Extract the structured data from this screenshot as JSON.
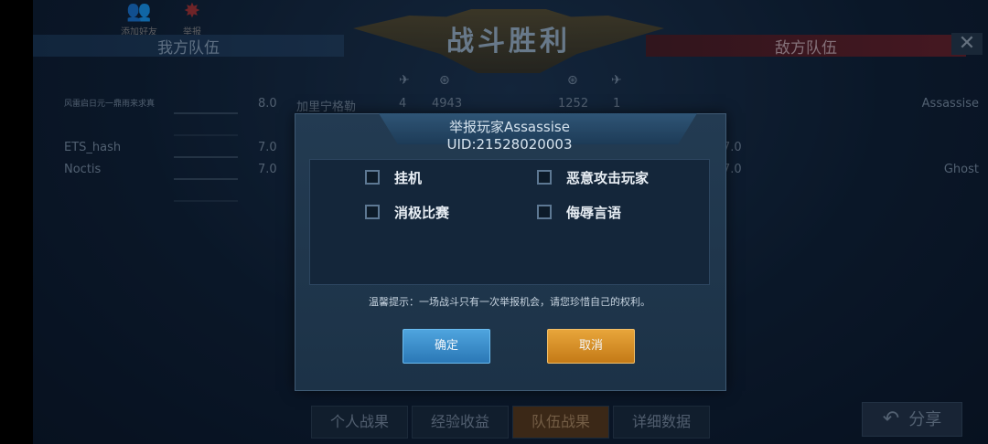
{
  "top_icons": [
    {
      "icon": "friends-icon",
      "label": "添加好友"
    },
    {
      "icon": "report-icon",
      "label": "举报"
    }
  ],
  "banner_title": "战斗胜利",
  "teams": {
    "ally": "我方队伍",
    "enemy": "敌方队伍"
  },
  "ally_rows": [
    {
      "name": "风雷启日元一鼎雨来求真",
      "score": "8.0",
      "enemy_name": "加里宁格勒",
      "k": "4",
      "dmg": "4943",
      "enemy_score": "1252",
      "enemy_k": "1",
      "enemy_player": "Assassise"
    },
    {
      "name": "",
      "score": "",
      "enemy_name": "",
      "k": "",
      "dmg": "",
      "enemy_score": "",
      "enemy_k": "",
      "enemy_player": ""
    },
    {
      "name": "ETS_hash",
      "score": "7.0",
      "enemy_name": "",
      "k": "",
      "dmg": "",
      "enemy_score": "7.0",
      "enemy_k": "",
      "enemy_player": ""
    },
    {
      "name": "Noctis",
      "score": "7.0",
      "enemy_name": "",
      "k": "",
      "dmg": "",
      "enemy_score": "7.0",
      "enemy_k": "",
      "enemy_player": "Ghost"
    }
  ],
  "bottom_tabs": [
    "个人战果",
    "经验收益",
    "队伍战果",
    "详细数据"
  ],
  "active_tab_index": 2,
  "share_label": "分享",
  "dialog": {
    "title": "举报玩家Assassise",
    "uid": "UID:21528020003",
    "options": [
      "挂机",
      "恶意攻击玩家",
      "消极比赛",
      "侮辱言语"
    ],
    "tip": "温馨提示：一场战斗只有一次举报机会，请您珍惜自己的权利。",
    "confirm_label": "确定",
    "cancel_label": "取消"
  },
  "colors": {
    "confirm": "#3a8fd0",
    "cancel": "#d98f28",
    "ally": "#1e3a5a",
    "enemy": "#5a1e26"
  }
}
